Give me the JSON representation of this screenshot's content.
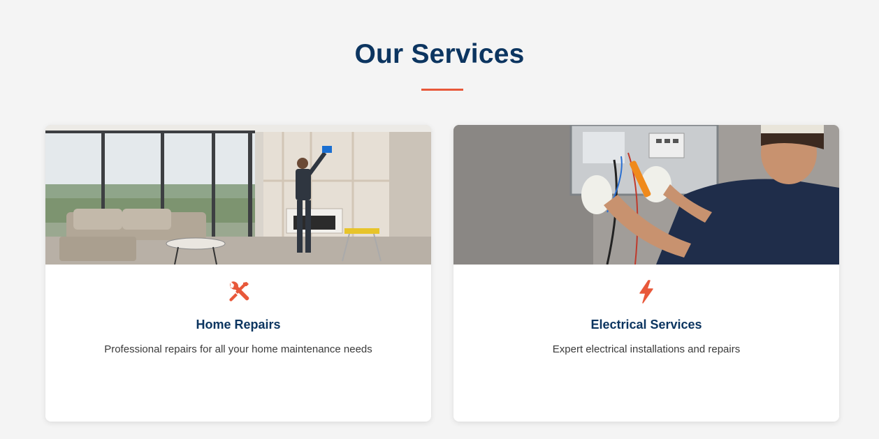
{
  "section": {
    "title": "Our Services"
  },
  "colors": {
    "accent": "#e8583a",
    "heading": "#0c3560",
    "background": "#f4f4f4"
  },
  "services": [
    {
      "title": "Home Repairs",
      "description": "Professional repairs for all your home maintenance needs",
      "icon": "tools-icon",
      "image": "handyman-drywall-photo"
    },
    {
      "title": "Electrical Services",
      "description": "Expert electrical installations and repairs",
      "icon": "lightning-bolt-icon",
      "image": "electrician-panel-photo"
    }
  ]
}
